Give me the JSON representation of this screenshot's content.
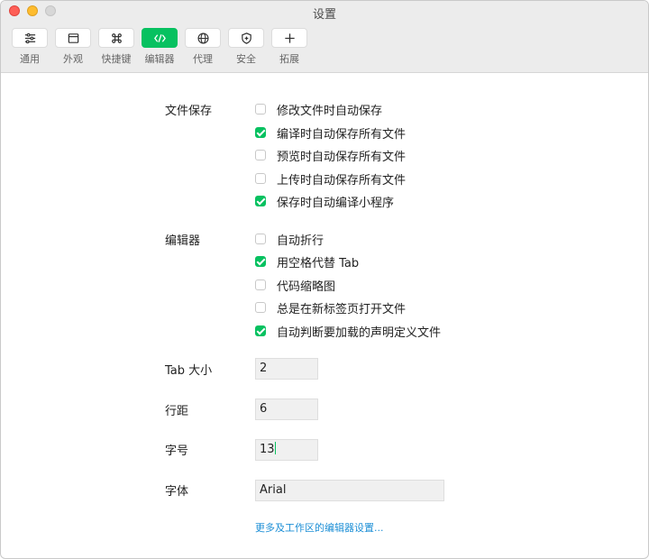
{
  "window": {
    "title": "设置"
  },
  "toolbar": {
    "items": [
      {
        "label": "通用",
        "icon": "sliders-icon"
      },
      {
        "label": "外观",
        "icon": "window-icon"
      },
      {
        "label": "快捷键",
        "icon": "command-icon"
      },
      {
        "label": "编辑器",
        "icon": "code-icon",
        "active": true
      },
      {
        "label": "代理",
        "icon": "globe-icon"
      },
      {
        "label": "安全",
        "icon": "shield-icon"
      },
      {
        "label": "拓展",
        "icon": "plus-icon"
      }
    ]
  },
  "accent": "#07c160",
  "file_save": {
    "label": "文件保存",
    "options": [
      {
        "label": "修改文件时自动保存",
        "checked": false
      },
      {
        "label": "编译时自动保存所有文件",
        "checked": true
      },
      {
        "label": "预览时自动保存所有文件",
        "checked": false
      },
      {
        "label": "上传时自动保存所有文件",
        "checked": false
      },
      {
        "label": "保存时自动编译小程序",
        "checked": true
      }
    ]
  },
  "editor": {
    "label": "编辑器",
    "options": [
      {
        "label": "自动折行",
        "checked": false
      },
      {
        "label": "用空格代替 Tab",
        "checked": true
      },
      {
        "label": "代码缩略图",
        "checked": false
      },
      {
        "label": "总是在新标签页打开文件",
        "checked": false
      },
      {
        "label": "自动判断要加载的声明定义文件",
        "checked": true
      }
    ]
  },
  "fields": {
    "tab_size": {
      "label": "Tab 大小",
      "value": "2"
    },
    "line_height": {
      "label": "行距",
      "value": "6"
    },
    "font_size": {
      "label": "字号",
      "value": "13"
    },
    "font": {
      "label": "字体",
      "value": "Arial"
    }
  },
  "more_link": "更多及工作区的编辑器设置..."
}
